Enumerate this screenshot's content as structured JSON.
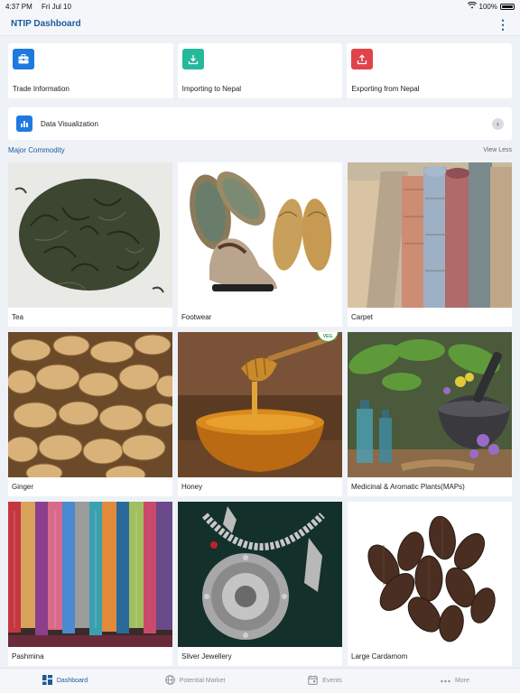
{
  "status": {
    "time": "4:37 PM",
    "date": "Fri Jul 10",
    "battery": "100%"
  },
  "header": {
    "title": "NTIP Dashboard"
  },
  "tiles": [
    {
      "label": "Trade Information",
      "color": "#1f7ae0",
      "icon": "briefcase-icon"
    },
    {
      "label": "Importing to Nepal",
      "color": "#27b89a",
      "icon": "download-icon"
    },
    {
      "label": "Exporting from Nepal",
      "color": "#e0434a",
      "icon": "upload-icon"
    }
  ],
  "dataviz": {
    "label": "Data Visualization",
    "icon": "bar-chart-icon"
  },
  "section": {
    "title": "Major Commodity",
    "toggle": "View Less"
  },
  "commodities": [
    {
      "label": "Tea",
      "image": "tea-leaves"
    },
    {
      "label": "Footwear",
      "image": "woven-slippers"
    },
    {
      "label": "Carpet",
      "image": "rolled-carpets"
    },
    {
      "label": "Ginger",
      "image": "ginger-roots"
    },
    {
      "label": "Honey",
      "image": "honey-bowl",
      "badge": "VEG"
    },
    {
      "label": "Medicinal & Aromatic Plants(MAPs)",
      "image": "herbs-mortar"
    },
    {
      "label": "Pashmina",
      "image": "pashmina-shawls"
    },
    {
      "label": "Silver Jewellery",
      "image": "silver-necklace"
    },
    {
      "label": "Large Cardamom",
      "image": "cardamom-pods"
    }
  ],
  "tabs": [
    {
      "label": "Dashboard",
      "icon": "dashboard-icon",
      "active": true
    },
    {
      "label": "Potential Market",
      "icon": "globe-icon"
    },
    {
      "label": "Events",
      "icon": "calendar-icon"
    },
    {
      "label": "More",
      "icon": "more-icon"
    }
  ]
}
